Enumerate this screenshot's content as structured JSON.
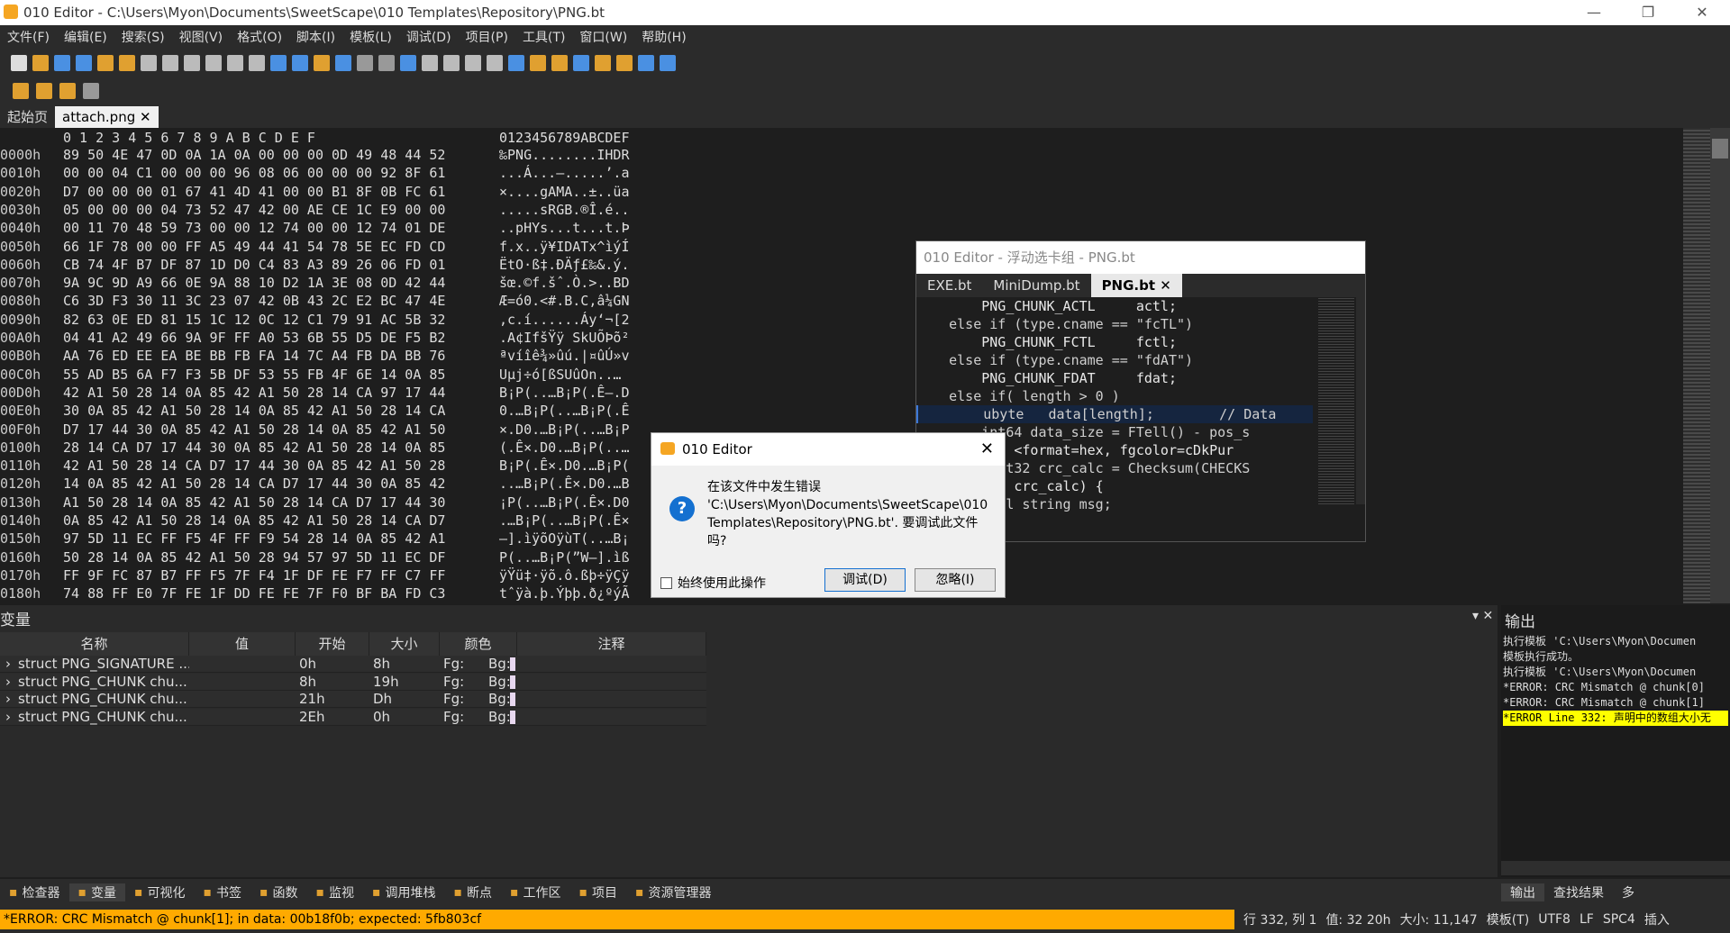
{
  "window": {
    "title": "010 Editor - C:\\Users\\Myon\\Documents\\SweetScape\\010 Templates\\Repository\\PNG.bt"
  },
  "menu": [
    "文件(F)",
    "编辑(E)",
    "搜索(S)",
    "视图(V)",
    "格式(O)",
    "脚本(I)",
    "模板(L)",
    "调试(D)",
    "项目(P)",
    "工具(T)",
    "窗口(W)",
    "帮助(H)"
  ],
  "tabs": {
    "start": "起始页",
    "file": "attach.png"
  },
  "hex": {
    "header_cols": "0  1  2  3  4  5  6  7  8  9  A  B  C  D  E  F",
    "header_ascii": "0123456789ABCDEF",
    "rows": [
      {
        "off": "0000h",
        "bytes": "89 50 4E 47 0D 0A 1A 0A 00 00 00 0D 49 48 44 52",
        "ascii": "‰PNG........IHDR"
      },
      {
        "off": "0010h",
        "bytes": "00 00 04 C1 00 00 00 96 08 06 00 00 00 92 8F 61",
        "ascii": "...Á...–.....’.a"
      },
      {
        "off": "0020h",
        "bytes": "D7 00 00 00 01 67 41 4D 41 00 00 B1 8F 0B FC 61",
        "ascii": "×....gAMA..±..üa"
      },
      {
        "off": "0030h",
        "bytes": "05 00 00 00 04 73 52 47 42 00 AE CE 1C E9 00 00",
        "ascii": ".....sRGB.®Î.é.."
      },
      {
        "off": "0040h",
        "bytes": "00 11 70 48 59 73 00 00 12 74 00 00 12 74 01 DE",
        "ascii": "..pHYs...t...t.Þ"
      },
      {
        "off": "0050h",
        "bytes": "66 1F 78 00 00 FF A5 49 44 41 54 78 5E EC FD CD",
        "ascii": "f.x..ÿ¥IDATx^ìýÍ"
      },
      {
        "off": "0060h",
        "bytes": "CB 74 4F B7 DF 87 1D D0 C4 83 A3 89 26 06 FD 01",
        "ascii": "ËtO·ß‡.ÐÄƒ£‰&.ý."
      },
      {
        "off": "0070h",
        "bytes": "9A 9C 9D A9 66 0E 9A 88 10 D2 1A 3E 08 0D 42 44",
        "ascii": "šœ.©f.šˆ.Ò.>..BD"
      },
      {
        "off": "0080h",
        "bytes": "C6 3D F3 30 11 3C 23 07 42 0B 43 2C E2 BC 47 4E",
        "ascii": "Æ=ó0.<#.B.C,â¼GN"
      },
      {
        "off": "0090h",
        "bytes": "82 63 0E ED 81 15 1C 12 0C 12 C1 79 91 AC 5B 32",
        "ascii": "‚c.í......Áy‘¬[2"
      },
      {
        "off": "00A0h",
        "bytes": "04 41 A2 49 66 9A 9F FF A0 53 6B 55 D5 DE F5 B2",
        "ascii": ".A¢IfšŸÿ SkUÕÞõ²"
      },
      {
        "off": "00B0h",
        "bytes": "AA 76 ED EE EA BE BB FB FA 14 7C A4 FB DA BB 76",
        "ascii": "ªvíîê¾»ûú.|¤ûÚ»v"
      },
      {
        "off": "00C0h",
        "bytes": "55 AD B5 6A F7 F3 5B DF 53 55 FB 4F 6E 14 0A 85",
        "ascii": "U­µj÷ó[ßSUûOn..…"
      },
      {
        "off": "00D0h",
        "bytes": "42 A1 50 28 14 0A 85 42 A1 50 28 14 CA 97 17 44",
        "ascii": "B¡P(..…B¡P(.Ê—.D"
      },
      {
        "off": "00E0h",
        "bytes": "30 0A 85 42 A1 50 28 14 0A 85 42 A1 50 28 14 CA",
        "ascii": "0.…B¡P(..…B¡P(.Ê"
      },
      {
        "off": "00F0h",
        "bytes": "D7 17 44 30 0A 85 42 A1 50 28 14 0A 85 42 A1 50",
        "ascii": "×.D0.…B¡P(..…B¡P"
      },
      {
        "off": "0100h",
        "bytes": "28 14 CA D7 17 44 30 0A 85 42 A1 50 28 14 0A 85",
        "ascii": "(.Ê×.D0.…B¡P(..…"
      },
      {
        "off": "0110h",
        "bytes": "42 A1 50 28 14 CA D7 17 44 30 0A 85 42 A1 50 28",
        "ascii": "B¡P(.Ê×.D0.…B¡P("
      },
      {
        "off": "0120h",
        "bytes": "14 0A 85 42 A1 50 28 14 CA D7 17 44 30 0A 85 42",
        "ascii": "..…B¡P(.Ê×.D0.…B"
      },
      {
        "off": "0130h",
        "bytes": "A1 50 28 14 0A 85 42 A1 50 28 14 CA D7 17 44 30",
        "ascii": "¡P(..…B¡P(.Ê×.D0"
      },
      {
        "off": "0140h",
        "bytes": "0A 85 42 A1 50 28 14 0A 85 42 A1 50 28 14 CA D7",
        "ascii": ".…B¡P(..…B¡P(.Ê×"
      },
      {
        "off": "0150h",
        "bytes": "97 5D 11 EC FF F5 4F FF F9 54 28 14 0A 85 42 A1",
        "ascii": "—].ìÿõOÿùT(..…B¡"
      },
      {
        "off": "0160h",
        "bytes": "50 28 14 0A 85 42 A1 50 28 94 57 97 5D 11 EC DF",
        "ascii": "P(..…B¡P(”W—].ìß"
      },
      {
        "off": "0170h",
        "bytes": "FF 9F FC 87 B7 FF F5 7F F4 1F DF FE F7 FF C7 FF",
        "ascii": "ÿŸü‡·ÿõ.ô.ßþ÷ÿÇÿ"
      },
      {
        "off": "0180h",
        "bytes": "74 88 FF E0 7F FE 1F DD FE FE 7F F0 BF BA FD C3",
        "ascii": "tˆÿà.þ.Ýþþ.ð¿ºýÃ"
      }
    ]
  },
  "float_window": {
    "title": "010 Editor - 浮动选卡组 - PNG.bt",
    "tabs": [
      "EXE.bt",
      "MiniDump.bt",
      "PNG.bt"
    ],
    "code": [
      "        PNG_CHUNK_ACTL     actl;",
      "    else if (type.cname == \"fcTL\")",
      "        PNG_CHUNK_FCTL     fctl;",
      "    else if (type.cname == \"fdAT\")",
      "        PNG_CHUNK_FDAT     fdat;",
      "    else if( length > 0 )",
      "        ubyte   data[length];        // Data",
      "        int64 data_size = FTell() - pos_s",
      "        crc <format=hex, fgcolor=cDkPur",
      "        uint32 crc_calc = Checksum(CHECKS",
      "      rc != crc_calc) {",
      "        ocal string msg;"
    ]
  },
  "dialog": {
    "title": "010 Editor",
    "message": "在该文件中发生错误 'C:\\Users\\Myon\\Documents\\SweetScape\\010 Templates\\Repository\\PNG.bt'. 要调试此文件吗?",
    "checkbox": "始终使用此操作",
    "debug_btn": "调试(D)",
    "ignore_btn": "忽略(I)"
  },
  "variables": {
    "title": "变量",
    "columns": [
      "名称",
      "值",
      "开始",
      "大小",
      "颜色",
      "注释"
    ],
    "rows": [
      {
        "name": "struct PNG_SIGNATURE ...",
        "value": "",
        "start": "0h",
        "size": "8h",
        "fg": "Fg:",
        "bg": "Bg:"
      },
      {
        "name": "struct PNG_CHUNK chu...",
        "value": "",
        "start": "8h",
        "size": "19h",
        "fg": "Fg:",
        "bg": "Bg:"
      },
      {
        "name": "struct PNG_CHUNK chu...",
        "value": "",
        "start": "21h",
        "size": "Dh",
        "fg": "Fg:",
        "bg": "Bg:"
      },
      {
        "name": "struct PNG_CHUNK chu...",
        "value": "",
        "start": "2Eh",
        "size": "0h",
        "fg": "Fg:",
        "bg": "Bg:"
      }
    ]
  },
  "output": {
    "title": "输出",
    "lines": [
      "执行模板 'C:\\Users\\Myon\\Documen",
      "模板执行成功。",
      "执行模板 'C:\\Users\\Myon\\Documen",
      "*ERROR: CRC Mismatch @ chunk[0]",
      "*ERROR: CRC Mismatch @ chunk[1]",
      "*ERROR Line 332: 声明中的数组大小无"
    ]
  },
  "bottom_tabs": [
    "检查器",
    "变量",
    "可视化",
    "书签",
    "函数",
    "监视",
    "调用堆栈",
    "断点",
    "工作区",
    "项目",
    "资源管理器"
  ],
  "right_tabs": [
    "输出",
    "查找结果",
    "多"
  ],
  "status": {
    "error": "*ERROR: CRC Mismatch @ chunk[1]; in data: 00b18f0b; expected: 5fb803cf",
    "pos": "行 332, 列 1",
    "value": "值: 32 20h",
    "size": "大小: 11,147",
    "mode": "模板(T)",
    "encoding": "UTF8",
    "eol": "LF",
    "tab": "SPC4",
    "ins": "插入"
  },
  "colors": {
    "error_bg": "#ffaa00",
    "accent": "#1470d0",
    "selection": "#26457a"
  }
}
